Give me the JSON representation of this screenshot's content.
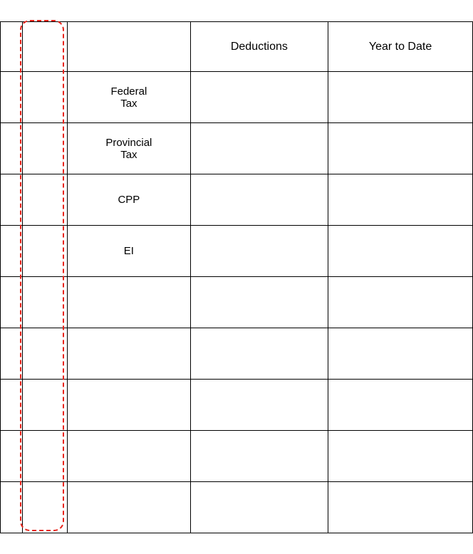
{
  "table": {
    "headers": {
      "col1": "",
      "col2": "",
      "col3": "",
      "deductions": "Deductions",
      "ytd": "Year to Date"
    },
    "rows": [
      {
        "label": "Federal\nTax",
        "deductions": "",
        "ytd": ""
      },
      {
        "label": "Provincial\nTax",
        "deductions": "",
        "ytd": ""
      },
      {
        "label": "CPP",
        "deductions": "",
        "ytd": ""
      },
      {
        "label": "EI",
        "deductions": "",
        "ytd": ""
      },
      {
        "label": "",
        "deductions": "",
        "ytd": ""
      },
      {
        "label": "",
        "deductions": "",
        "ytd": ""
      },
      {
        "label": "",
        "deductions": "",
        "ytd": ""
      },
      {
        "label": "",
        "deductions": "",
        "ytd": ""
      },
      {
        "label": "",
        "deductions": "",
        "ytd": ""
      }
    ]
  }
}
